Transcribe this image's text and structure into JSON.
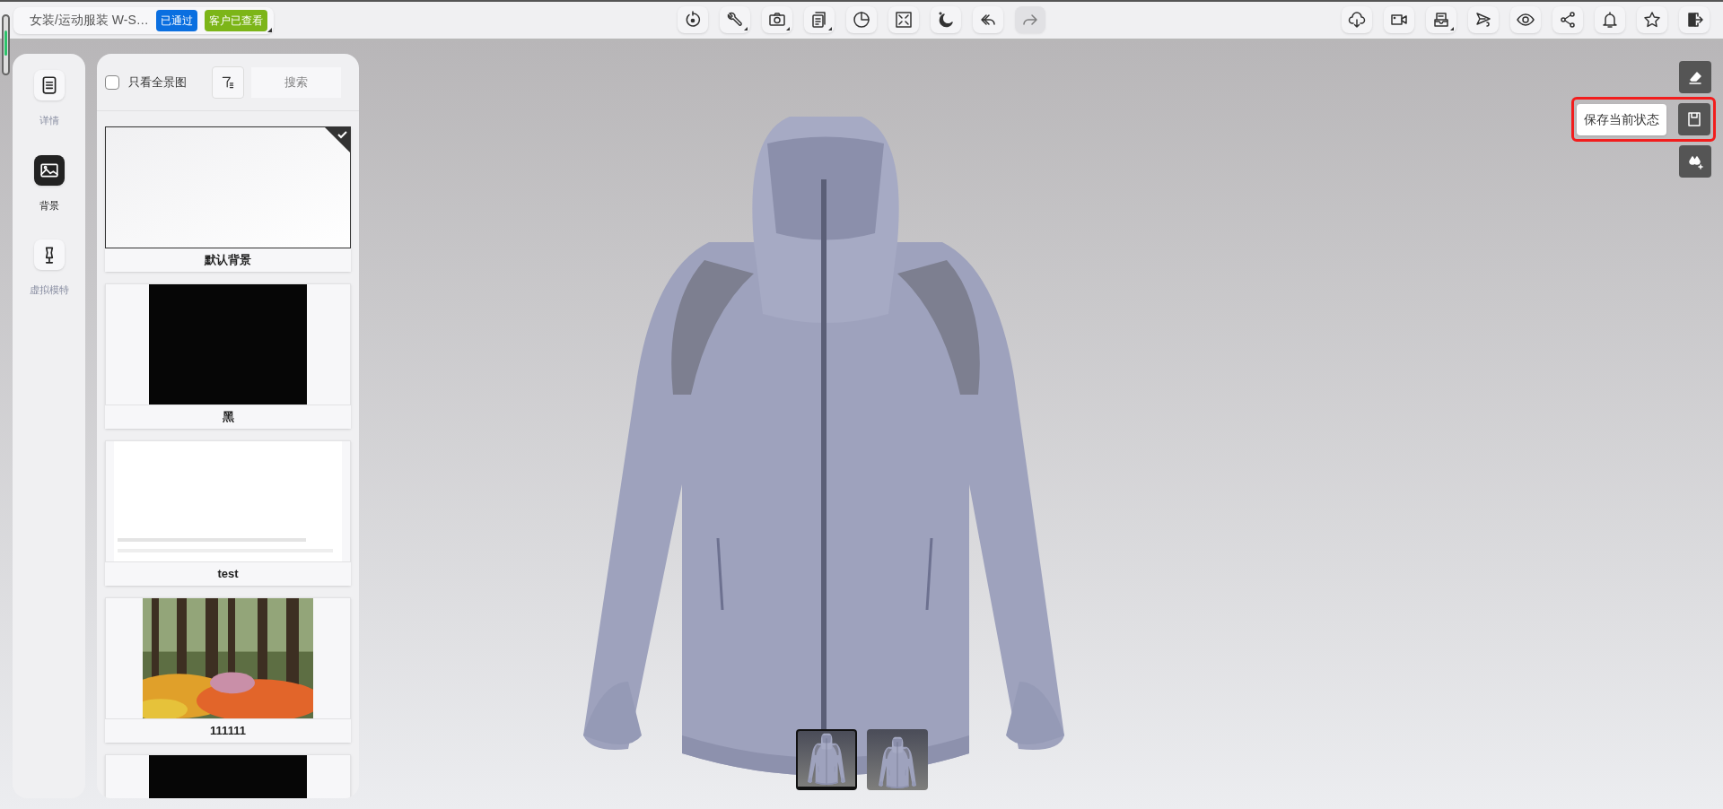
{
  "document": {
    "title": "女装/运动服装 W-S…",
    "badges": [
      {
        "text": "已通过",
        "color": "#0a6fe0"
      },
      {
        "text": "客户已查看",
        "color": "#7cb518"
      }
    ]
  },
  "toolbar_center": [
    {
      "dropdown": false,
      "disabled": false
    },
    {
      "dropdown": true,
      "disabled": false
    },
    {
      "dropdown": true,
      "disabled": false
    },
    {
      "dropdown": true,
      "disabled": false
    },
    {
      "dropdown": false,
      "disabled": false
    },
    {
      "dropdown": false,
      "disabled": false
    },
    {
      "dropdown": false,
      "disabled": false
    },
    {
      "dropdown": false,
      "disabled": false
    },
    {
      "dropdown": false,
      "disabled": true
    }
  ],
  "toolbar_right": [
    {
      "dropdown": false
    },
    {
      "dropdown": false
    },
    {
      "dropdown": true
    },
    {
      "dropdown": false
    },
    {
      "dropdown": false
    },
    {
      "dropdown": false
    },
    {
      "dropdown": false
    },
    {
      "dropdown": false
    },
    {
      "dropdown": false
    }
  ],
  "sidebar": {
    "items": [
      {
        "label": "详情",
        "selected": false
      },
      {
        "label": "背景",
        "selected": true
      },
      {
        "label": "虚拟模特",
        "selected": false
      }
    ]
  },
  "panel": {
    "panorama_only": {
      "label": "只看全景图",
      "checked": false
    },
    "search": {
      "placeholder": "搜索"
    },
    "backgrounds": [
      {
        "kind": "blank",
        "label": "默认背景",
        "selected": true
      },
      {
        "kind": "black",
        "label": "黑",
        "selected": false
      },
      {
        "kind": "document",
        "label": "test",
        "selected": false
      },
      {
        "kind": "picture",
        "label": "111111",
        "selected": false
      },
      {
        "kind": "black",
        "selected": false
      }
    ]
  },
  "side_tools": [
    {
      "highlighted": false
    },
    {
      "highlighted": true,
      "tooltip": "保存当前状态"
    },
    {
      "highlighted": false
    }
  ],
  "views": [
    {
      "selected": true
    },
    {
      "selected": false
    }
  ]
}
